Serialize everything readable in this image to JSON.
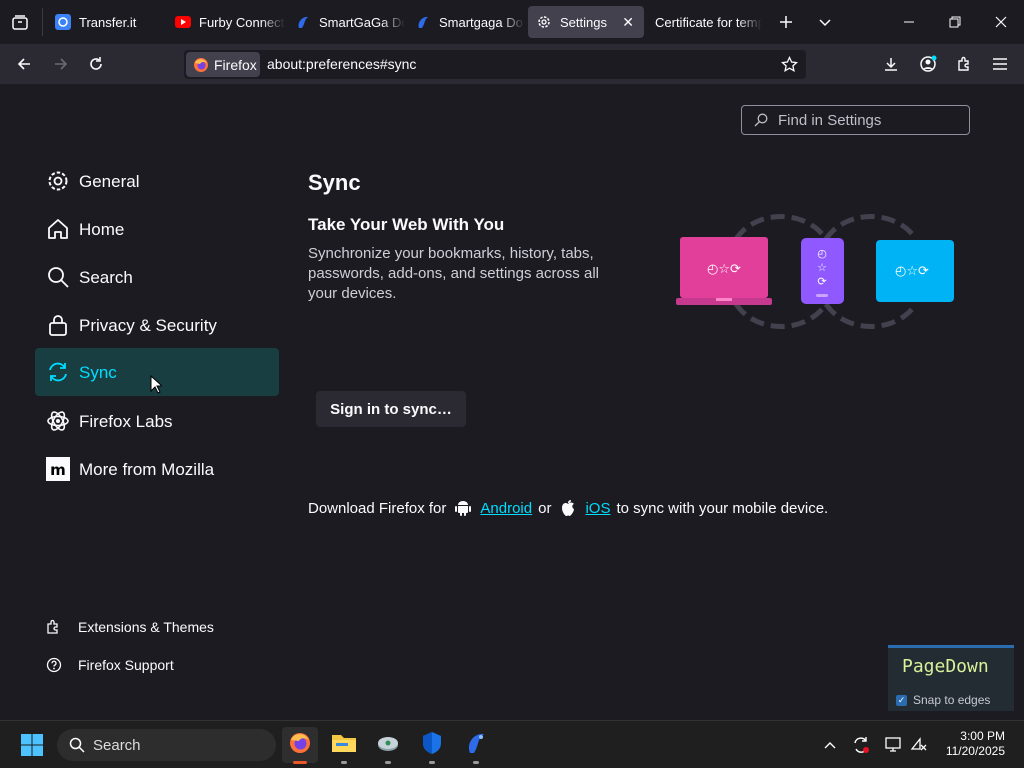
{
  "browser": {
    "tabs": [
      {
        "title": "Transfer.it",
        "icon": "transfer-icon"
      },
      {
        "title": "Furby Connect",
        "icon": "youtube-icon"
      },
      {
        "title": "SmartGaGa Do",
        "icon": "smartgaga-icon"
      },
      {
        "title": "Smartgaga Do",
        "icon": "smartgaga-icon"
      },
      {
        "title": "Settings",
        "icon": "gear-icon",
        "active": true
      },
      {
        "title": "Certificate for temp",
        "icon": ""
      }
    ],
    "identity_label": "Firefox",
    "url": "about:preferences#sync"
  },
  "settings": {
    "search_placeholder": "Find in Settings",
    "categories": [
      {
        "label": "General",
        "icon": "gear-icon"
      },
      {
        "label": "Home",
        "icon": "home-icon"
      },
      {
        "label": "Search",
        "icon": "search-icon"
      },
      {
        "label": "Privacy & Security",
        "icon": "lock-icon"
      },
      {
        "label": "Sync",
        "icon": "sync-icon",
        "selected": true
      },
      {
        "label": "Firefox Labs",
        "icon": "labs-icon"
      },
      {
        "label": "More from Mozilla",
        "icon": "mozilla-icon"
      }
    ],
    "footer_links": [
      {
        "label": "Extensions & Themes",
        "icon": "puzzle-icon"
      },
      {
        "label": "Firefox Support",
        "icon": "help-icon"
      }
    ],
    "sync": {
      "heading": "Sync",
      "subheading": "Take Your Web With You",
      "description": "Synchronize your bookmarks, history, tabs, passwords, add-ons, and settings across all your devices.",
      "signin_button": "Sign in to sync…",
      "download_prefix": "Download Firefox for",
      "android_link": "Android",
      "or_text": "or",
      "ios_link": "iOS",
      "download_suffix": "to sync with your mobile device."
    }
  },
  "overlay": {
    "key": "PageDown",
    "snap_label": "Snap to edges"
  },
  "taskbar": {
    "search_label": "Search",
    "time": "3:00 PM",
    "date": "11/20/2025"
  },
  "colors": {
    "accent": "#00ddff",
    "selected_bg": "#183e42",
    "page_bg": "#1c1b22",
    "toolbar_bg": "#2b2a33"
  }
}
